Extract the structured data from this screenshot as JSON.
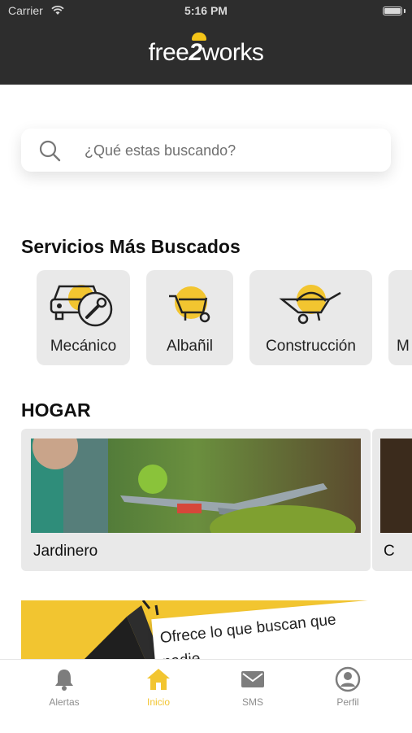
{
  "status_bar": {
    "carrier": "Carrier",
    "time": "5:16 PM"
  },
  "header": {
    "logo_part1": "free",
    "logo_part2": "2",
    "logo_part3": "works"
  },
  "search": {
    "placeholder": "¿Qué estas buscando?"
  },
  "most_searched": {
    "title": "Servicios Más Buscados",
    "items": [
      {
        "label": "Mecánico",
        "icon": "mechanic-car-wrench-icon"
      },
      {
        "label": "Albañil",
        "icon": "wheelbarrow-icon"
      },
      {
        "label": "Construcción",
        "icon": "wheelbarrow-icon"
      },
      {
        "label": "M",
        "icon": "partial-icon"
      }
    ]
  },
  "home": {
    "title": "HOGAR",
    "items": [
      {
        "label": "Jardinero"
      },
      {
        "label": "C"
      }
    ]
  },
  "banner": {
    "text": "Ofrece lo que buscan que nadie."
  },
  "tabbar": {
    "items": [
      {
        "label": "Alertas",
        "icon": "bell-icon"
      },
      {
        "label": "Inicio",
        "icon": "home-icon"
      },
      {
        "label": "SMS",
        "icon": "mail-icon"
      },
      {
        "label": "Perfil",
        "icon": "profile-icon"
      }
    ]
  },
  "colors": {
    "accent": "#f2c530",
    "header_bg": "#2d2d2d",
    "card_bg": "#e9e9e9"
  }
}
